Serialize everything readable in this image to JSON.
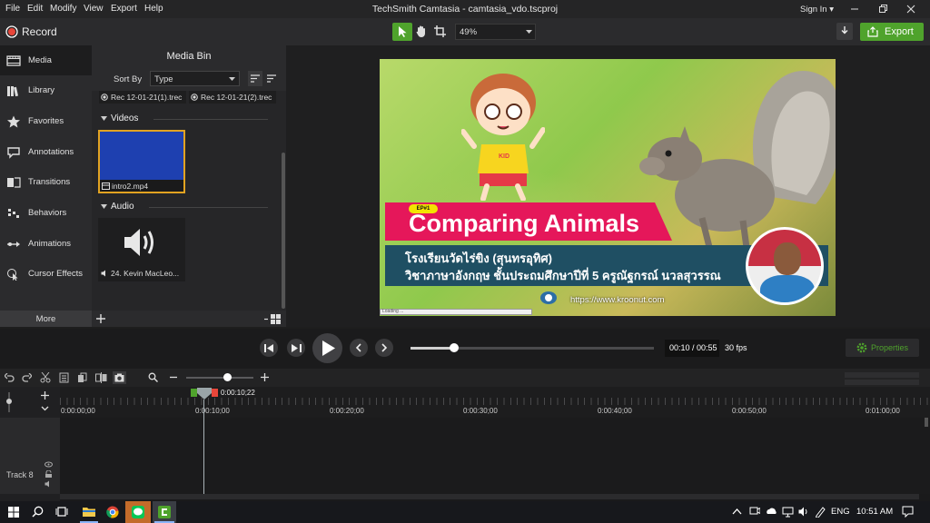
{
  "menu": [
    "File",
    "Edit",
    "Modify",
    "View",
    "Export",
    "Help"
  ],
  "app_title": "TechSmith Camtasia - camtasia_vdo.tscproj",
  "sign_in": "Sign In",
  "sign_in_caret": "▾",
  "record_label": "Record",
  "zoom_value": "49%",
  "export_label": "Export",
  "tools": [
    {
      "label": "Media"
    },
    {
      "label": "Library"
    },
    {
      "label": "Favorites"
    },
    {
      "label": "Annotations"
    },
    {
      "label": "Transitions"
    },
    {
      "label": "Behaviors"
    },
    {
      "label": "Animations"
    },
    {
      "label": "Cursor Effects"
    }
  ],
  "more_label": "More",
  "media_bin": {
    "title": "Media Bin",
    "sort_by_label": "Sort By",
    "sort_value": "Type",
    "recordings": [
      "Rec 12-01-21(1).trec",
      "Rec 12-01-21(2).trec"
    ],
    "videos_header": "Videos",
    "video_item": "intro2.mp4",
    "audio_header": "Audio",
    "audio_item": "24. Kevin MacLeo..."
  },
  "preview": {
    "episode_badge": "EP#1",
    "headline": "Comparing Animals",
    "school_line": "โรงเรียนวัดไร่ขิง (สุนทรอุทิศ)",
    "subject_line": "วิชาภาษาอังกฤษ  ชั้นประถมศึกษาปีที่ 5  ครูณัฐกรณ์ นวลสุวรรณ",
    "website": "https://www.kroonut.com",
    "kid_shirt": "KID",
    "loading_text": "Loading ..."
  },
  "playback": {
    "progress": 0.18,
    "time": "00:10 / 00:55",
    "fps": "30 fps",
    "properties_label": "Properties"
  },
  "timeline": {
    "playhead_time": "0:00:10;22",
    "ticks": [
      "0:00:00;00",
      "0:00:10;00",
      "0:00:20;00",
      "0:00:30;00",
      "0:00:40;00",
      "0:00:50;00",
      "0:01:00;00"
    ],
    "track_label": "Track 8",
    "zoom_level": 0.62
  },
  "taskbar": {
    "lang": "ENG",
    "clock": "10:51 AM"
  },
  "colors": {
    "accent_green": "#4fa32c",
    "record_red": "#e8463a",
    "banner_pink": "#e5175a",
    "banner_teal": "#1f4f63",
    "thumb_blue": "#1e40b0",
    "selection_gold": "#e2a321"
  }
}
